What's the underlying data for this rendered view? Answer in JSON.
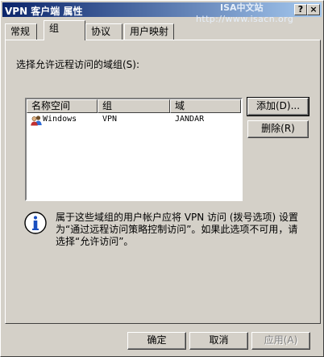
{
  "window": {
    "title": "VPN 客户端 属性",
    "watermark_line1": "ISA中文站",
    "watermark_line2": "http://www.isacn.org",
    "help_glyph": "?",
    "close_glyph": "×"
  },
  "tabs": [
    {
      "label": "常规"
    },
    {
      "label": "组",
      "active": true
    },
    {
      "label": "协议"
    },
    {
      "label": "用户映射"
    }
  ],
  "prompt": "选择允许远程访问的域组(S):",
  "list": {
    "columns": [
      "名称空间",
      "组",
      "域"
    ],
    "rows": [
      {
        "namespace": "Windows",
        "group": "VPN",
        "domain": "JANDAR",
        "icon": "users-icon"
      }
    ]
  },
  "buttons": {
    "add": "添加(D)...",
    "remove": "删除(R)",
    "ok": "确定",
    "cancel": "取消",
    "apply": "应用(A)"
  },
  "info": {
    "icon": "info-icon",
    "text": "属于这些域组的用户帐户应将 VPN 访问 (拨号选项) 设置为“通过远程访问策略控制访问”。如果此选项不可用，请选择“允许访问”。"
  },
  "colors": {
    "title_gradient_start": "#0a246a",
    "title_gradient_end": "#a6caf0",
    "face": "#d4d0c8"
  }
}
